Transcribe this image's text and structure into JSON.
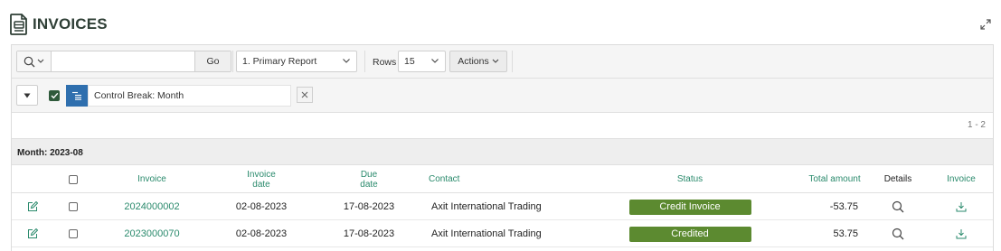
{
  "header": {
    "title": "INVOICES",
    "title_icon": "invoice-document-icon",
    "expand_icon": "expand-icon"
  },
  "toolbar": {
    "search_placeholder": "",
    "search_value": "",
    "go_label": "Go",
    "report_selected": "1. Primary Report",
    "rows_label": "Rows",
    "rows_value": "15",
    "actions_label": "Actions"
  },
  "filter": {
    "label": "Control Break: Month",
    "checked": true
  },
  "pagination": "1 - 2",
  "control_break": "Month: 2023-08",
  "columns": {
    "invoice": "Invoice",
    "invoice_date": "Invoice date",
    "due_date": "Due date",
    "contact": "Contact",
    "status": "Status",
    "total_amount": "Total amount",
    "details": "Details",
    "invoice_download": "Invoice"
  },
  "rows": [
    {
      "invoice": "2024000002",
      "invoice_date": "02-08-2023",
      "due_date": "17-08-2023",
      "contact": "Axit International Trading",
      "status": "Credit Invoice",
      "total_amount": "-53.75"
    },
    {
      "invoice": "2023000070",
      "invoice_date": "02-08-2023",
      "due_date": "17-08-2023",
      "contact": "Axit International Trading",
      "status": "Credited",
      "total_amount": "53.75"
    }
  ],
  "colors": {
    "accent": "#2a8a6c",
    "status_badge": "#5c8a30",
    "control_break_blue": "#2f6fae",
    "title": "#2f3f36"
  }
}
